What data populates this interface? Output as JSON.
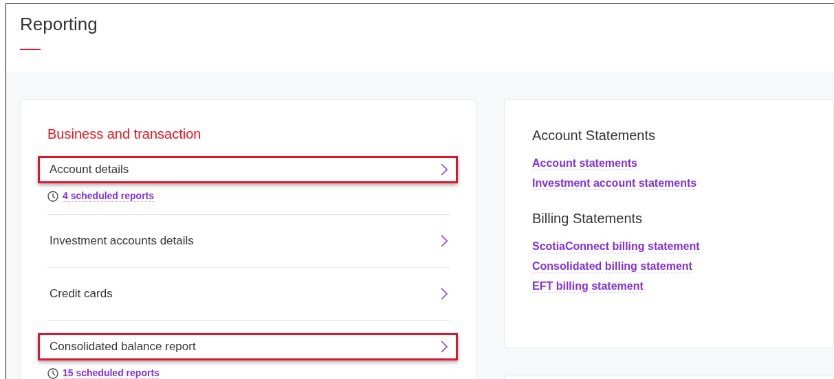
{
  "page": {
    "title": "Reporting"
  },
  "business_card": {
    "heading": "Business and transaction",
    "items": [
      {
        "label": "Account details",
        "highlighted": true,
        "scheduled": "4 scheduled reports"
      },
      {
        "label": "Investment accounts details",
        "highlighted": false
      },
      {
        "label": "Credit cards",
        "highlighted": false
      },
      {
        "label": "Consolidated balance report",
        "highlighted": true,
        "scheduled": "15 scheduled reports"
      }
    ]
  },
  "statements_card": {
    "sections": [
      {
        "heading": "Account Statements",
        "links": [
          "Account statements",
          "Investment account statements"
        ]
      },
      {
        "heading": "Billing Statements",
        "links": [
          "ScotiaConnect billing statement",
          "Consolidated billing statement",
          "EFT billing statement"
        ]
      }
    ]
  }
}
